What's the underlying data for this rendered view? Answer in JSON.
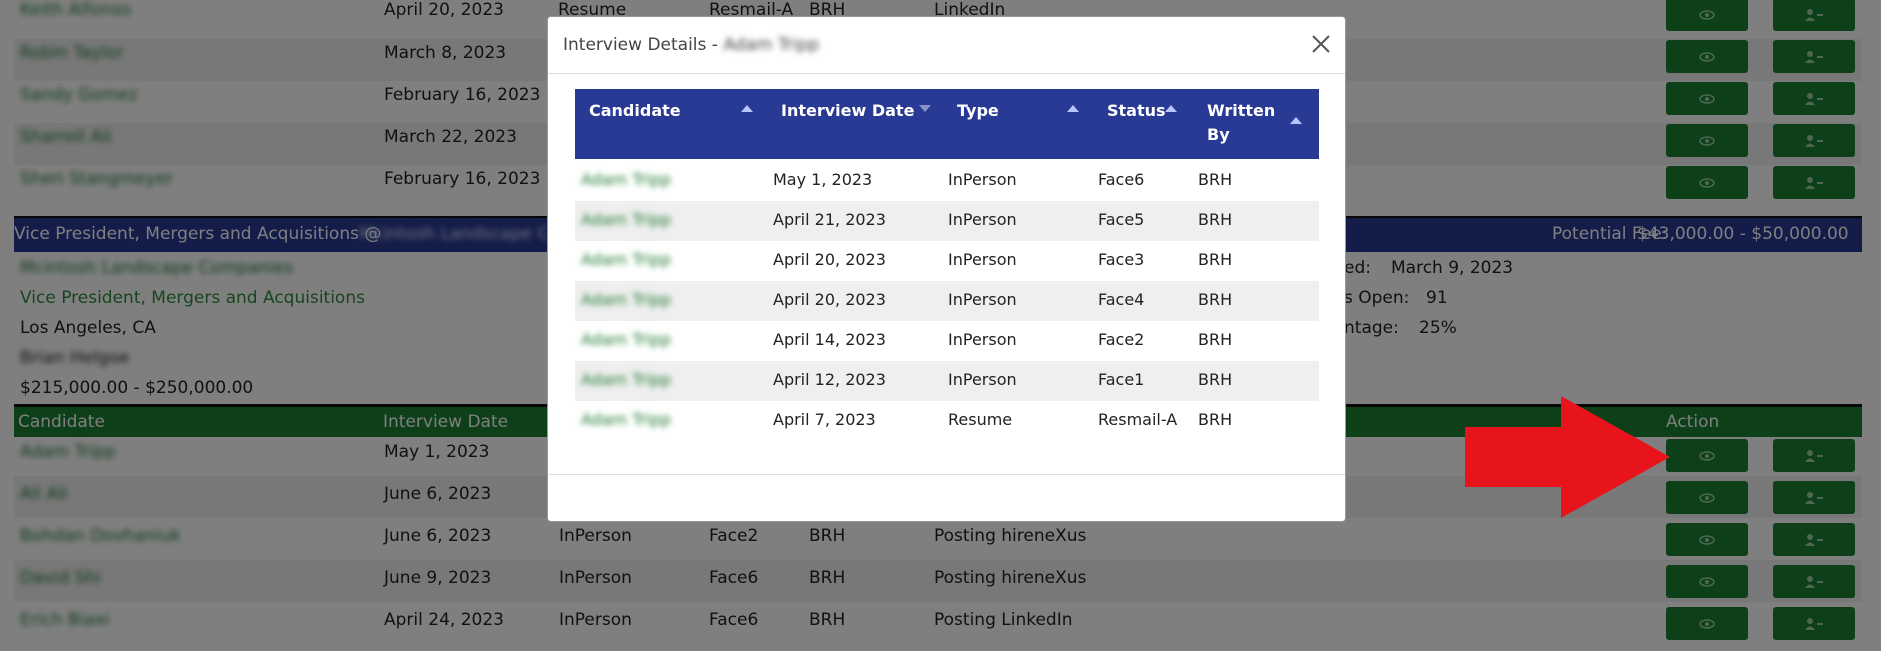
{
  "background": {
    "top_rows": [
      {
        "candidate": "Keith Alfonso",
        "date": "April 20, 2023",
        "type": "Resume",
        "status": "Resmail-A",
        "by": "BRH",
        "source": "LinkedIn"
      },
      {
        "candidate": "Robin Taylor",
        "date": "March 8, 2023",
        "type": "",
        "status": "",
        "by": "",
        "source": ""
      },
      {
        "candidate": "Sandy Gomez",
        "date": "February 16, 2023",
        "type": "",
        "status": "",
        "by": "",
        "source": ""
      },
      {
        "candidate": "Sharrell Ali",
        "date": "March 22, 2023",
        "type": "",
        "status": "",
        "by": "",
        "source": ""
      },
      {
        "candidate": "Sheri Stangmeyer",
        "date": "February 16, 2023",
        "type": "",
        "status": "",
        "by": "",
        "source": ""
      }
    ],
    "job": {
      "title_prefix": "Vice President, Mergers and Acquisitions @",
      "company_blur": "Mcintosh Landscape Co",
      "fee_label": "Potential Fee:",
      "fee_value": "$43,000.00 - $50,000.00",
      "company_name": "Mcintosh Landscape Companies",
      "position_link": "Vice President, Mergers and Acquisitions",
      "location": "Los Angeles, CA",
      "contact": "Brian Helgoe",
      "salary": "$215,000.00 - $250,000.00",
      "right_label1": "ed:",
      "right_value1": "March 9, 2023",
      "right_label2": "s Open:",
      "right_value2": "91",
      "right_label3": "ntage:",
      "right_value3": "25%"
    },
    "columns": {
      "candidate": "Candidate",
      "interview_date": "Interview Date",
      "action": "Action"
    },
    "bottom_rows": [
      {
        "candidate": "Adam Tripp",
        "date": "May 1, 2023",
        "type": "",
        "status": "",
        "by": "",
        "source": ""
      },
      {
        "candidate": "Ali Ali",
        "date": "June 6, 2023",
        "type": "",
        "status": "",
        "by": "",
        "source": ""
      },
      {
        "candidate": "Bohdan Dovhaniuk",
        "date": "June 6, 2023",
        "type": "InPerson",
        "status": "Face2",
        "by": "BRH",
        "source": "Posting hireneXus"
      },
      {
        "candidate": "David Shi",
        "date": "June 9, 2023",
        "type": "InPerson",
        "status": "Face6",
        "by": "BRH",
        "source": "Posting hireneXus"
      },
      {
        "candidate": "Erich Biaxi",
        "date": "April 24, 2023",
        "type": "InPerson",
        "status": "Face6",
        "by": "BRH",
        "source": "Posting LinkedIn"
      }
    ]
  },
  "modal": {
    "title_prefix": "Interview Details -",
    "title_name": "Adam Tripp",
    "headers": {
      "candidate": "Candidate",
      "interview_date": "Interview Date",
      "type": "Type",
      "status": "Status",
      "written_by_1": "Written",
      "written_by_2": "By"
    },
    "rows": [
      {
        "candidate": "Adam Tripp",
        "date": "May 1, 2023",
        "type": "InPerson",
        "status": "Face6",
        "by": "BRH"
      },
      {
        "candidate": "Adam Tripp",
        "date": "April 21, 2023",
        "type": "InPerson",
        "status": "Face5",
        "by": "BRH"
      },
      {
        "candidate": "Adam Tripp",
        "date": "April 20, 2023",
        "type": "InPerson",
        "status": "Face3",
        "by": "BRH"
      },
      {
        "candidate": "Adam Tripp",
        "date": "April 20, 2023",
        "type": "InPerson",
        "status": "Face4",
        "by": "BRH"
      },
      {
        "candidate": "Adam Tripp",
        "date": "April 14, 2023",
        "type": "InPerson",
        "status": "Face2",
        "by": "BRH"
      },
      {
        "candidate": "Adam Tripp",
        "date": "April 12, 2023",
        "type": "InPerson",
        "status": "Face1",
        "by": "BRH"
      },
      {
        "candidate": "Adam Tripp",
        "date": "April 7, 2023",
        "type": "Resume",
        "status": "Resmail-A",
        "by": "BRH"
      }
    ]
  },
  "colors": {
    "brand_blue": "#283a94",
    "action_green": "#1a7f32",
    "link_green": "#1e7a33",
    "annotation_red": "#e8141c"
  },
  "icons": {
    "view": "eye-icon",
    "remove": "user-minus-icon",
    "close": "close-icon",
    "annotation": "red-arrow"
  }
}
